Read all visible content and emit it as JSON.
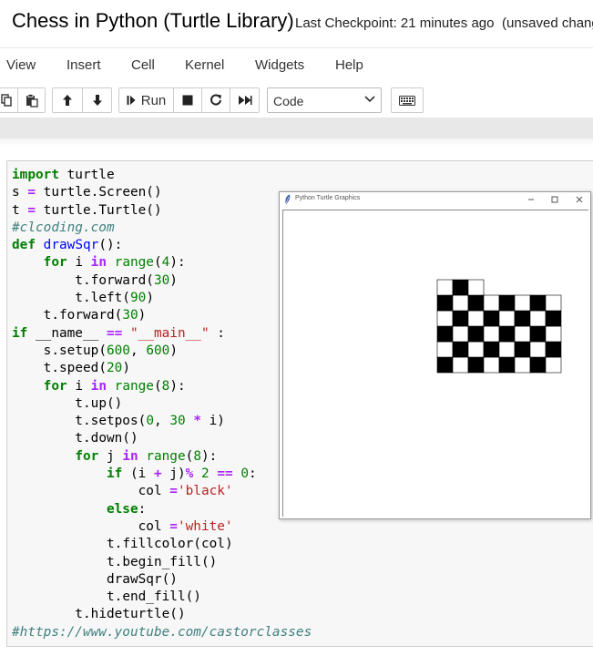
{
  "header": {
    "notebook_title": "Chess in Python (Turtle Library)",
    "checkpoint": "Last Checkpoint: 21 minutes ago",
    "unsaved": "(unsaved changes)"
  },
  "menu": {
    "items": [
      {
        "label": "View",
        "icon": ""
      },
      {
        "label": "Insert",
        "icon": ""
      },
      {
        "label": "Cell",
        "icon": ""
      },
      {
        "label": "Kernel",
        "icon": ""
      },
      {
        "label": "Widgets",
        "icon": ""
      },
      {
        "label": "Help",
        "icon": ""
      }
    ]
  },
  "toolbar": {
    "copy_icon": "copy-icon",
    "paste_icon": "paste-icon",
    "move_up_icon": "arrow-up-icon",
    "move_down_icon": "arrow-down-icon",
    "run_label": "Run",
    "stop_icon": "stop-icon",
    "restart_icon": "restart-icon",
    "fast_forward_icon": "fast-forward-icon",
    "cell_type": "Code",
    "keyboard_icon": "keyboard-icon"
  },
  "cell": {
    "code_lines": [
      "import turtle",
      "s = turtle.Screen()",
      "t = turtle.Turtle()",
      "#clcoding.com",
      "def drawSqr():",
      "    for i in range(4):",
      "        t.forward(30)",
      "        t.left(90)",
      "    t.forward(30)",
      "if __name__ == \"__main__\" :",
      "    s.setup(600, 600)",
      "    t.speed(20)",
      "    for i in range(8):",
      "        t.up()",
      "        t.setpos(0, 30 * i)",
      "        t.down()",
      "        for j in range(8):",
      "            if (i + j)% 2 == 0:",
      "                col ='black'",
      "            else:",
      "                col ='white'",
      "            t.fillcolor(col)",
      "            t.begin_fill()",
      "            drawSqr()",
      "            t.end_fill()",
      "        t.hideturtle()",
      "#https://www.youtube.com/castorclasses"
    ]
  },
  "turtle_window": {
    "title": "Python Turtle Graphics",
    "minimize_icon": "minimize-icon",
    "maximize_icon": "maximize-icon",
    "close_icon": "close-icon",
    "board": {
      "rows_complete": 5,
      "cols": 8,
      "partial_row_cells": 3,
      "colors": {
        "black": "#000000",
        "white": "#ffffff"
      }
    }
  }
}
